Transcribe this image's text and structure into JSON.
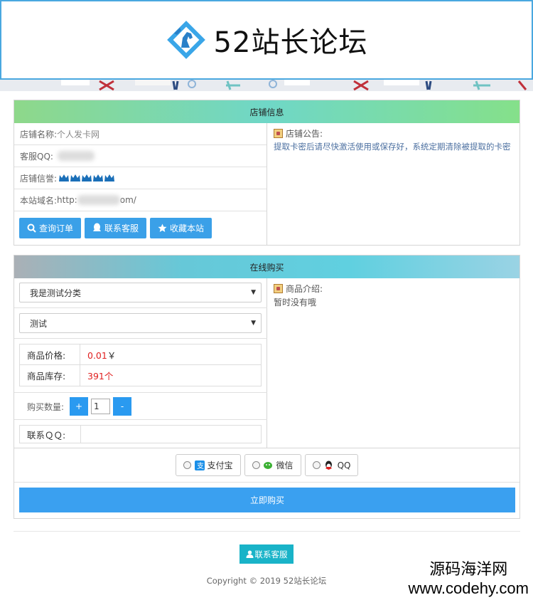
{
  "header": {
    "site_title": "52站长论坛",
    "logo_icon": "horse-logo-icon"
  },
  "shop_info": {
    "panel_title": "店铺信息",
    "shop_name_label": "店铺名称:",
    "shop_name_value": "个人发卡网",
    "service_qq_label": "客服QQ:",
    "reputation_label": "店铺信誉:",
    "domain_label": "本站域名:",
    "domain_prefix": "http:",
    "domain_suffix": "om/",
    "buttons": {
      "query_order": "查询订单",
      "contact_service": "联系客服",
      "bookmark": "收藏本站"
    },
    "notice_title": "店铺公告:",
    "notice_text": "提取卡密后请尽快激活使用或保存好，系统定期清除被提取的卡密"
  },
  "purchase": {
    "panel_title": "在线购买",
    "category_selected": "我是测试分类",
    "product_selected": "测试",
    "price_label": "商品价格:",
    "price_value": "0.01",
    "price_unit": "￥",
    "stock_label": "商品库存:",
    "stock_value": "391",
    "stock_unit": "个",
    "quantity_label": "购买数量:",
    "quantity_plus": "+",
    "quantity_value": "1",
    "quantity_minus": "-",
    "contact_qq_label": "联系ＱＱ:",
    "intro_title": "商品介绍:",
    "intro_text": "暂时没有哦",
    "payment_methods": [
      "支付宝",
      "微信",
      "QQ"
    ],
    "buy_now": "立即购买"
  },
  "footer": {
    "contact_button": "联系客服",
    "copyright": "Copyright © 2019 52站长论坛"
  },
  "watermark": {
    "line1": "源码海洋网",
    "line2": "www.codehy.com"
  },
  "colors": {
    "accent_blue": "#3aa0e8",
    "price_red": "#e02020",
    "footer_teal": "#19b3c8"
  }
}
